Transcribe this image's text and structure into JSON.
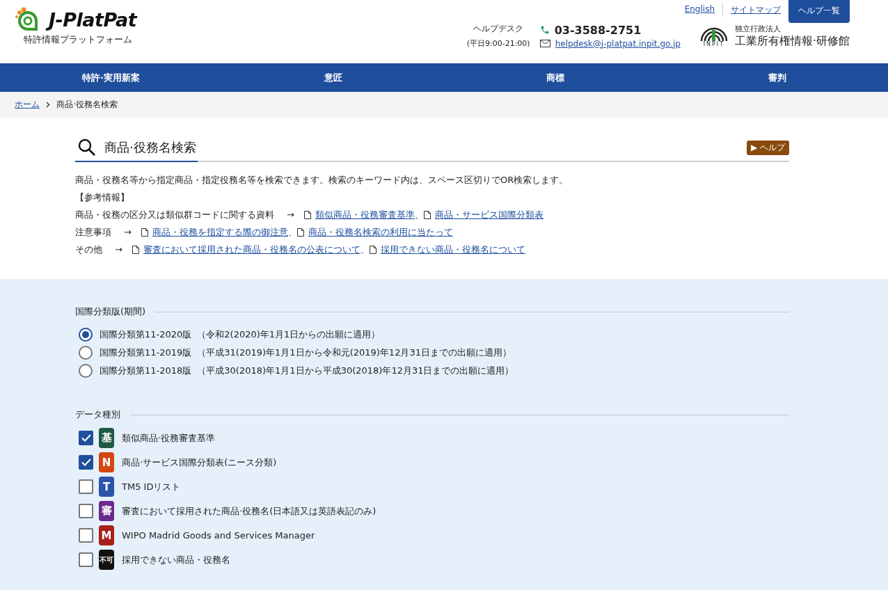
{
  "logo": {
    "name": "J-PlatPat",
    "subtitle": "特許情報プラットフォーム"
  },
  "top_links": [
    {
      "label": "English"
    },
    {
      "label": "サイトマップ"
    }
  ],
  "help_button": "ヘルプ一覧",
  "helpdesk": {
    "label": "ヘルプデスク",
    "hours": "(平日9:00-21:00)",
    "phone": "03-3588-2751",
    "email": "helpdesk@j-platpat.inpit.go.jp"
  },
  "inpit": {
    "mark": "INPIT",
    "org_type": "独立行政法人",
    "org_name": "工業所有権情報·研修館"
  },
  "nav": [
    {
      "label": "特許·実用新案"
    },
    {
      "label": "意匠"
    },
    {
      "label": "商標"
    },
    {
      "label": "審判"
    }
  ],
  "breadcrumb": [
    {
      "label": "ホーム",
      "kind": "link"
    },
    {
      "label": "商品·役務名検索",
      "kind": "current"
    }
  ],
  "page_title": "商品·役務名検索",
  "help_badge": "▶ ヘルプ",
  "description": "商品・役務名等から指定商品・指定役務名等を検索できます。検索のキーワード内は、スペース区切りでOR検索します。",
  "reference_heading": "【参考情報】",
  "references": [
    {
      "label": "商品・役務の区分又は類似群コードに関する資料",
      "arrow": "→",
      "items": [
        {
          "kind": "link",
          "text": "類似商品・役務審査基準"
        },
        {
          "kind": "sep",
          "text": "、"
        },
        {
          "kind": "link",
          "text": "商品・サービス国際分類表"
        }
      ]
    },
    {
      "label": "注意事項",
      "arrow": "→",
      "items": [
        {
          "kind": "link",
          "text": "商品・役務を指定する際の御注意 "
        },
        {
          "kind": "sep",
          "text": "、"
        },
        {
          "kind": "link",
          "text": "商品・役務名検索の利用に当たって"
        }
      ]
    },
    {
      "label": "その他",
      "arrow": "→",
      "items": [
        {
          "kind": "link",
          "text": "審査において採用された商品・役務名の公表について"
        },
        {
          "kind": "sep",
          "text": "、"
        },
        {
          "kind": "link",
          "text": "採用できない商品・役務名について"
        }
      ]
    }
  ],
  "edition": {
    "legend": "国際分類版(期間)",
    "options": [
      {
        "label": "国際分類第11-2020版",
        "period": "（令和2(2020)年1月1日からの出願に適用）",
        "selected": true
      },
      {
        "label": "国際分類第11-2019版",
        "period": "（平成31(2019)年1月1日から令和元(2019)年12月31日までの出願に適用）",
        "selected": false
      },
      {
        "label": "国際分類第11-2018版",
        "period": "（平成30(2018)年1月1日から平成30(2018)年12月31日までの出願に適用）",
        "selected": false
      }
    ]
  },
  "data_types": {
    "legend": "データ種別",
    "options": [
      {
        "badge": "基",
        "color": "#1e5a44",
        "label": "類似商品·役務審査基準",
        "checked": true
      },
      {
        "badge": "N",
        "color": "#d4460f",
        "label": "商品·サービス国際分類表(ニース分類)",
        "checked": true
      },
      {
        "badge": "T",
        "color": "#2a55a8",
        "label": "TM5 IDリスト",
        "checked": false
      },
      {
        "badge": "審",
        "color": "#6a2a8e",
        "label": "審査において採用された商品·役務名(日本語又は英語表記のみ)",
        "checked": false
      },
      {
        "badge": "M",
        "color": "#a8201a",
        "label": "WIPO Madrid Goods and Services Manager",
        "checked": false
      },
      {
        "badge": "不可",
        "color": "#111111",
        "label": "採用できない商品・役務名",
        "checked": false
      }
    ]
  }
}
